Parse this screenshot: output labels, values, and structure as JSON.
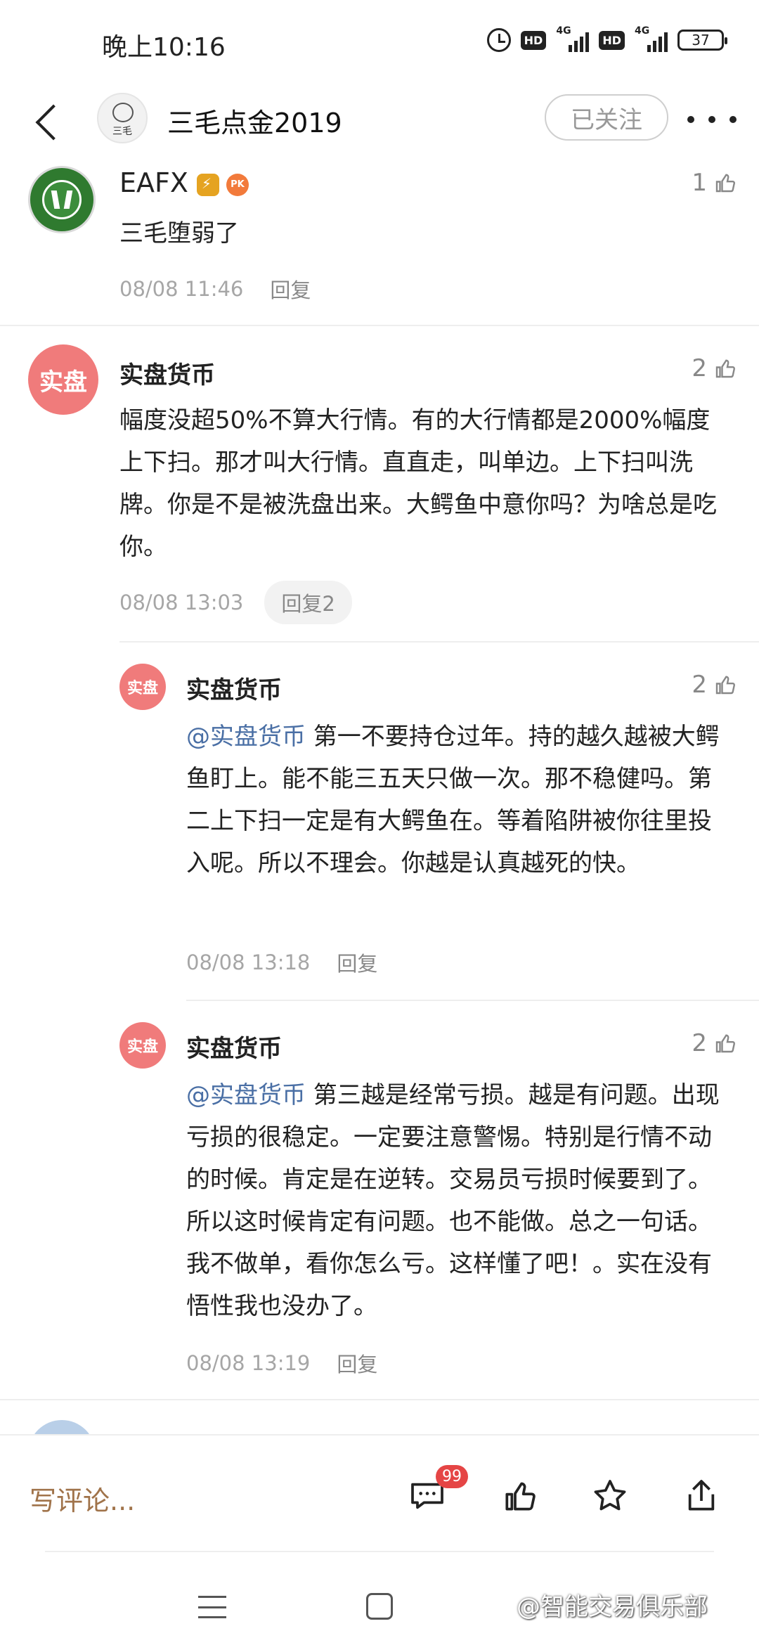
{
  "status_bar": {
    "time": "晚上10:16",
    "hd1": "HD",
    "net1": "4G",
    "hd2": "HD",
    "net2": "4G",
    "battery": "37"
  },
  "header": {
    "avatar_text": "三毛",
    "title": "三毛点金2019",
    "follow_label": "已关注"
  },
  "comments": [
    {
      "user": "EAFX",
      "badge_pk": "PK",
      "text": "三毛堕弱了",
      "time": "08/08 11:46",
      "reply": "回复",
      "likes": "1"
    },
    {
      "user": "实盘货币",
      "avatar_text": "实盘",
      "text": "幅度没超50%不算大行情。有的大行情都是2000%幅度上下扫。那才叫大行情。直直走，叫单边。上下扫叫洗牌。你是不是被洗盘出来。大鳄鱼中意你吗？为啥总是吃你。",
      "time": "08/08 13:03",
      "reply": "回复2",
      "likes": "2"
    }
  ],
  "replies": [
    {
      "user": "实盘货币",
      "avatar_text": "实盘",
      "mention": "@实盘货币",
      "text": " 第一不要持仓过年。持的越久越被大鳄鱼盯上。能不能三五天只做一次。那不稳健吗。第二上下扫一定是有大鳄鱼在。等着陷阱被你往里投入呢。所以不理会。你越是认真越死的快。",
      "time": "08/08 13:18",
      "reply": "回复",
      "likes": "2"
    },
    {
      "user": "实盘货币",
      "avatar_text": "实盘",
      "mention": "@实盘货币",
      "text": " 第三越是经常亏损。越是有问题。出现亏损的很稳定。一定要注意警惕。特别是行情不动的时候。肯定是在逆转。交易员亏损时候要到了。所以这时候肯定有问题。也不能做。总之一句话。我不做单，看你怎么亏。这样懂了吧！。实在没有悟性我也没办了。",
      "time": "08/08 13:19",
      "reply": "回复",
      "likes": "2"
    }
  ],
  "bottom_bar": {
    "write_comment": "写评论...",
    "comment_count": "99"
  },
  "watermark": "@智能交易俱乐部",
  "icons": [
    "back-icon",
    "more-icon",
    "thumb-up-icon",
    "comment-icon",
    "star-icon",
    "share-icon",
    "menu-icon",
    "home-icon"
  ]
}
